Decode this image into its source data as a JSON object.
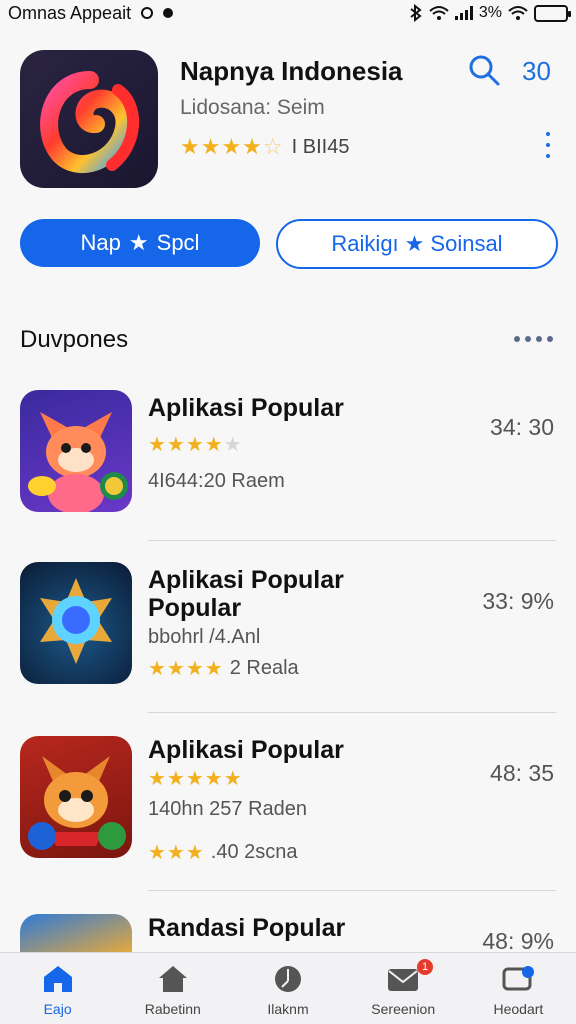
{
  "status_bar": {
    "carrier": "Omnas Appeait",
    "battery_percent": "3%"
  },
  "hero": {
    "title": "Napnya Indonesia",
    "subtitle": "Lidosana: Seim",
    "rating": 4.5,
    "rating_text": "I BII45",
    "count": "30"
  },
  "actions": {
    "primary_left": "Nap",
    "primary_right": "Spcl",
    "secondary_left": "Raikigı",
    "secondary_right": "Soinsal"
  },
  "section": {
    "title": "Duvpones"
  },
  "apps": [
    {
      "title": "Aplikasi Popular",
      "rating": 4.5,
      "line1": "4I644:20 Raem",
      "right": "34: 30"
    },
    {
      "title": "Aplikasi Popular",
      "subtitle": "Popular",
      "line1": "bbohrl /4.Anl",
      "rating": 4,
      "rating_text": "2 Reala",
      "right": "33: 9%"
    },
    {
      "title": "Aplikasi Popular",
      "rating": 4.5,
      "line1": "140hn 257 Raden",
      "rating2": 3,
      "rating2_text": ".40 2scna",
      "right": "48: 35"
    },
    {
      "title": "Randasi Popular",
      "right": "48: 9%"
    }
  ],
  "tabs": [
    {
      "label": "Eajo",
      "active": true
    },
    {
      "label": "Rabetinn",
      "active": false
    },
    {
      "label": "Ilaknm",
      "active": false
    },
    {
      "label": "Sereenion",
      "active": false,
      "badge": "1"
    },
    {
      "label": "Heodart",
      "active": false
    }
  ],
  "colors": {
    "accent": "#1566e8",
    "star": "#f2b01e",
    "badge": "#e53b2e"
  }
}
